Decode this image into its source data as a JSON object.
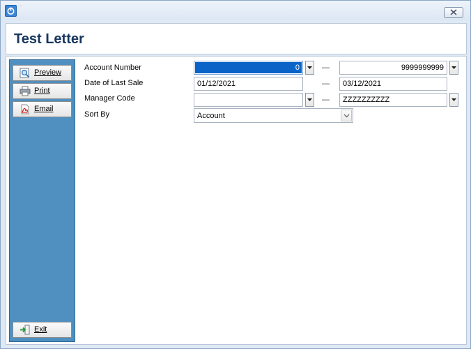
{
  "window": {
    "title_dot": "˙",
    "close_label": "Close"
  },
  "header": {
    "title": "Test Letter"
  },
  "sidebar": {
    "buttons": [
      {
        "label": "Preview",
        "icon": "preview-icon"
      },
      {
        "label": "Print",
        "icon": "printer-icon"
      },
      {
        "label": "Email",
        "icon": "pdf-email-icon"
      },
      {
        "label": "Exit",
        "icon": "exit-icon"
      }
    ]
  },
  "form": {
    "account_number": {
      "label": "Account Number",
      "from": "0",
      "to": "9999999999"
    },
    "date_of_last_sale": {
      "label": "Date of Last Sale",
      "from": "01/12/2021",
      "to": "03/12/2021"
    },
    "manager_code": {
      "label": "Manager Code",
      "from": "",
      "to": "ZZZZZZZZZZ"
    },
    "sort_by": {
      "label": "Sort By",
      "value": "Account"
    },
    "range_dash": "—"
  },
  "colors": {
    "sidebar": "#4f90c0",
    "title": "#17365d",
    "selection": "#0a64c8"
  }
}
